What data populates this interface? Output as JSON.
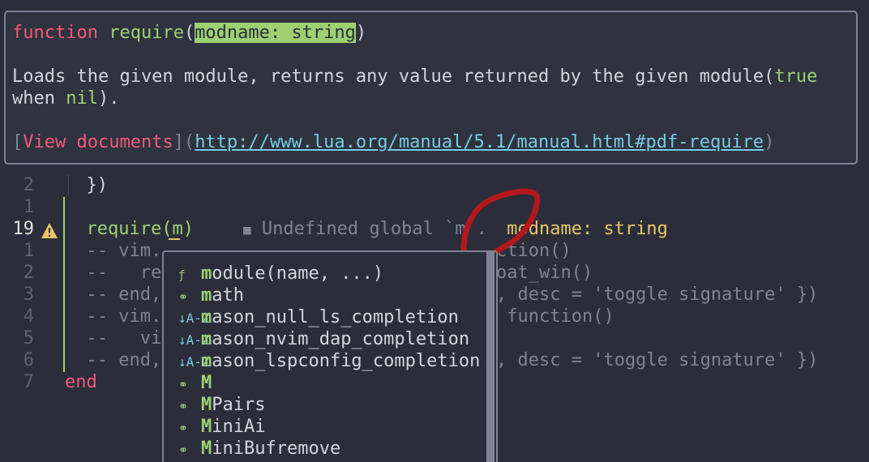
{
  "hover": {
    "sig_keyword": "function",
    "sig_name": "require",
    "sig_open": "(",
    "sig_param": "modname: string",
    "sig_close": ")",
    "desc_a": "Loads the given module, returns any value returned by the given module(",
    "desc_true": "true",
    "desc_b": "when ",
    "desc_nil": "nil",
    "desc_c": ").",
    "link_open": "[",
    "link_text": "View documents",
    "link_mid": "](",
    "link_url": "http://www.lua.org/manual/5.1/manual.html#pdf-require",
    "link_close": ")"
  },
  "editor": {
    "lines": [
      {
        "num": "2",
        "text": "  })",
        "current": false
      },
      {
        "num": "1",
        "text": "",
        "current": false
      },
      {
        "num": "19",
        "text": "  require(m)",
        "current": true
      },
      {
        "num": "1",
        "text": "  -- vim.",
        "current": false
      },
      {
        "num": "2",
        "text": "  --   re",
        "current": false
      },
      {
        "num": "3",
        "text": "  -- end,",
        "current": false
      },
      {
        "num": "4",
        "text": "  -- vim.",
        "current": false
      },
      {
        "num": "5",
        "text": "  --   vi",
        "current": false
      },
      {
        "num": "6",
        "text": "  -- end,",
        "current": false
      },
      {
        "num": "7",
        "text": "end",
        "current": false
      }
    ],
    "diagnostic": "Undefined global `m`.",
    "diag_square": "■",
    "sig_hint_icons": "",
    "sig_hint": "modname: string",
    "right_fragments": [
      "ction()",
      "oat_win()",
      ", desc = 'toggle signature' })",
      " function()",
      "",
      ", desc = 'toggle signature' })"
    ]
  },
  "completion": {
    "items": [
      {
        "icon": "ƒ",
        "match": "m",
        "rest": "odule(name, ...)"
      },
      {
        "icon": "⚭",
        "match": "m",
        "rest": "ath"
      },
      {
        "icon": "↓A-Z",
        "match": "m",
        "rest": "ason_null_ls_completion"
      },
      {
        "icon": "↓A-Z",
        "match": "m",
        "rest": "ason_nvim_dap_completion"
      },
      {
        "icon": "↓A-Z",
        "match": "m",
        "rest": "ason_lspconfig_completion"
      },
      {
        "icon": "⚭",
        "match": "M",
        "rest": ""
      },
      {
        "icon": "⚭",
        "match": "M",
        "rest": "Pairs"
      },
      {
        "icon": "⚭",
        "match": "M",
        "rest": "iniAi"
      },
      {
        "icon": "⚭",
        "match": "M",
        "rest": "iniBufremove"
      }
    ]
  },
  "colors": {
    "background": "#2b2e3a",
    "keyword": "#f2597a",
    "function": "#9ed072",
    "link": "#76cce0",
    "hint": "#e7c664"
  }
}
